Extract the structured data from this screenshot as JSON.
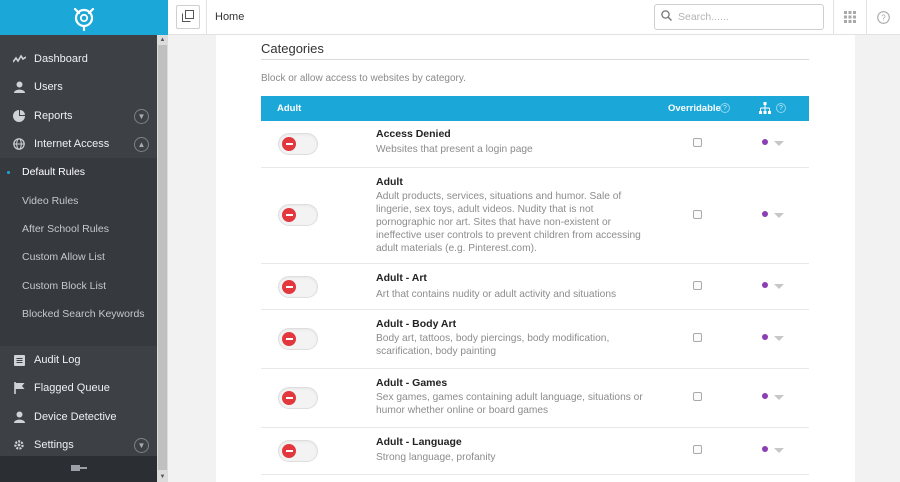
{
  "sidebar": {
    "items": [
      {
        "label": "Dashboard",
        "icon": "activity-icon"
      },
      {
        "label": "Users",
        "icon": "user-icon"
      },
      {
        "label": "Reports",
        "icon": "pie-chart-icon",
        "expandable": true
      },
      {
        "label": "Internet Access",
        "icon": "globe-icon",
        "expandable": true,
        "expanded": true
      }
    ],
    "subitems": [
      {
        "label": "Default Rules",
        "active": true
      },
      {
        "label": "Video Rules"
      },
      {
        "label": "After School Rules"
      },
      {
        "label": "Custom Allow List"
      },
      {
        "label": "Custom Block List"
      },
      {
        "label": "Blocked Search Keywords"
      }
    ],
    "items2": [
      {
        "label": "Audit Log",
        "icon": "list-icon"
      },
      {
        "label": "Flagged Queue",
        "icon": "flag-icon"
      },
      {
        "label": "Device Detective",
        "icon": "user-icon"
      },
      {
        "label": "Settings",
        "icon": "gear-icon",
        "expandable": true
      }
    ]
  },
  "topbar": {
    "breadcrumb": "Home",
    "search_placeholder": "Search......"
  },
  "page": {
    "title": "Categories",
    "description": "Block or allow access to websites by category."
  },
  "table": {
    "header_category": "Adult",
    "header_overridable": "Overridable",
    "rows": [
      {
        "name": "Access Denied",
        "description": "Websites that present a login page",
        "blocked": true,
        "overridable": false
      },
      {
        "name": "Adult",
        "description": "Adult products, services, situations and humor. Sale of lingerie, sex toys, adult videos. Nudity that is not pornographic nor art. Sites that have non-existent or ineffective user controls to prevent children from accessing adult materials (e.g. Pinterest.com).",
        "blocked": true,
        "overridable": false
      },
      {
        "name": "Adult - Art",
        "description": "Art that contains nudity or adult activity and situations",
        "blocked": true,
        "overridable": false
      },
      {
        "name": "Adult - Body Art",
        "description": "Body art, tattoos, body piercings, body modification, scarification, body painting",
        "blocked": true,
        "overridable": false
      },
      {
        "name": "Adult - Games",
        "description": "Sex games, games containing adult language, situations or humor whether online or board games",
        "blocked": true,
        "overridable": false
      },
      {
        "name": "Adult - Language",
        "description": "Strong language, profanity",
        "blocked": true,
        "overridable": false
      }
    ]
  },
  "colors": {
    "accent": "#1ba8d8",
    "sidebar_bg": "#3d4146",
    "block_red": "#e2373d",
    "group_dot": "#8b3fb5"
  }
}
